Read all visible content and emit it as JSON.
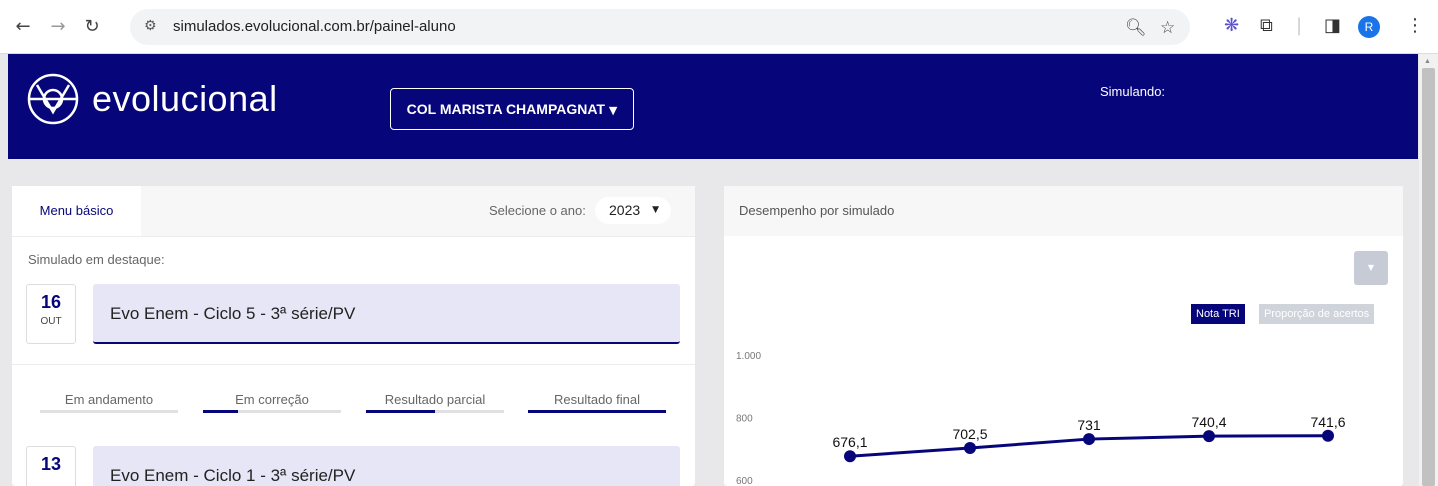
{
  "browser": {
    "url": "simulados.evolucional.com.br/painel-aluno",
    "profile_initial": "R"
  },
  "header": {
    "logo_text": "evolucional",
    "school_button": "COL MARISTA CHAMPAGNAT",
    "simulating_label": "Simulando:"
  },
  "left_panel": {
    "tab_label": "Menu básico",
    "year_label": "Selecione o ano:",
    "year_value": "2023",
    "featured_label": "Simulado em destaque:",
    "featured": {
      "day": "16",
      "month": "OUT",
      "title": "Evo Enem - Ciclo 5 - 3ª série/PV"
    },
    "status_tabs": [
      {
        "label": "Em andamento",
        "fill": 0
      },
      {
        "label": "Em correção",
        "fill": 0.25
      },
      {
        "label": "Resultado parcial",
        "fill": 0.5
      },
      {
        "label": "Resultado final",
        "fill": 1
      }
    ],
    "exams": [
      {
        "day": "13",
        "title": "Evo Enem - Ciclo 1 - 3ª série/PV"
      }
    ]
  },
  "right_panel": {
    "title": "Desempenho por simulado",
    "toggle_active": "Nota TRI",
    "toggle_inactive": "Proporção de acertos"
  },
  "colors": {
    "brand": "#06067a",
    "accent_bg": "#e6e6f6"
  },
  "chart_data": {
    "type": "line",
    "values": [
      676.1,
      702.5,
      731,
      740.4,
      741.6
    ],
    "value_labels": [
      "676,1",
      "702,5",
      "731",
      "740,4",
      "741,6"
    ],
    "y_ticks": [
      600,
      800,
      1000
    ],
    "y_tick_labels": [
      "600",
      "800",
      "1.000"
    ],
    "ylim": [
      600,
      1000
    ]
  }
}
